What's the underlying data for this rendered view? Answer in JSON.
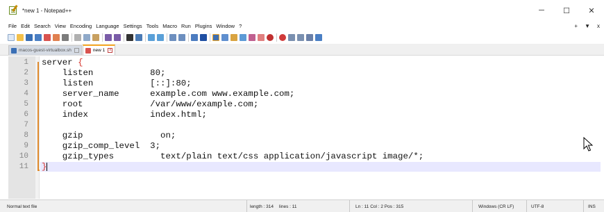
{
  "window": {
    "title": "*new 1 - Notepad++",
    "controls": {
      "minimize": "─",
      "maximize": "☐",
      "close": "✕"
    }
  },
  "menu": {
    "items": [
      "File",
      "Edit",
      "Search",
      "View",
      "Encoding",
      "Language",
      "Settings",
      "Tools",
      "Macro",
      "Run",
      "Plugins",
      "Window",
      "?"
    ],
    "right": {
      "plus": "+",
      "arrow": "▼",
      "close": "x"
    }
  },
  "tabs": [
    {
      "label": "macos-guest-virtualbox.sh",
      "close": "",
      "active": false
    },
    {
      "label": "new 1",
      "close": "x",
      "active": true
    }
  ],
  "editor": {
    "lines": [
      {
        "num": "1",
        "text": "server ",
        "brace": "{"
      },
      {
        "num": "2",
        "text": "    listen           80;"
      },
      {
        "num": "3",
        "text": "    listen           [::]:80;"
      },
      {
        "num": "4",
        "text": "    server_name      example.com www.example.com;"
      },
      {
        "num": "5",
        "text": "    root             /var/www/example.com;"
      },
      {
        "num": "6",
        "text": "    index            index.html;"
      },
      {
        "num": "7",
        "text": ""
      },
      {
        "num": "8",
        "text": "    gzip               on;"
      },
      {
        "num": "9",
        "text": "    gzip_comp_level  3;"
      },
      {
        "num": "10",
        "text": "    gzip_types         text/plain text/css application/javascript image/*;"
      },
      {
        "num": "11",
        "text": "",
        "brace": "}"
      }
    ]
  },
  "statusbar": {
    "filetype": "Normal text file",
    "length": "length : 314",
    "lines": "lines : 11",
    "position": "Ln : 11    Col : 2    Pos : 315",
    "eol": "Windows (CR LF)",
    "encoding": "UTF-8",
    "mode": "INS"
  },
  "colors": {
    "fold_marker": "#e08b2d",
    "brace": "#d6332a",
    "current_line": "#e8e8ff",
    "active_tab_accent": "#f5a623"
  }
}
